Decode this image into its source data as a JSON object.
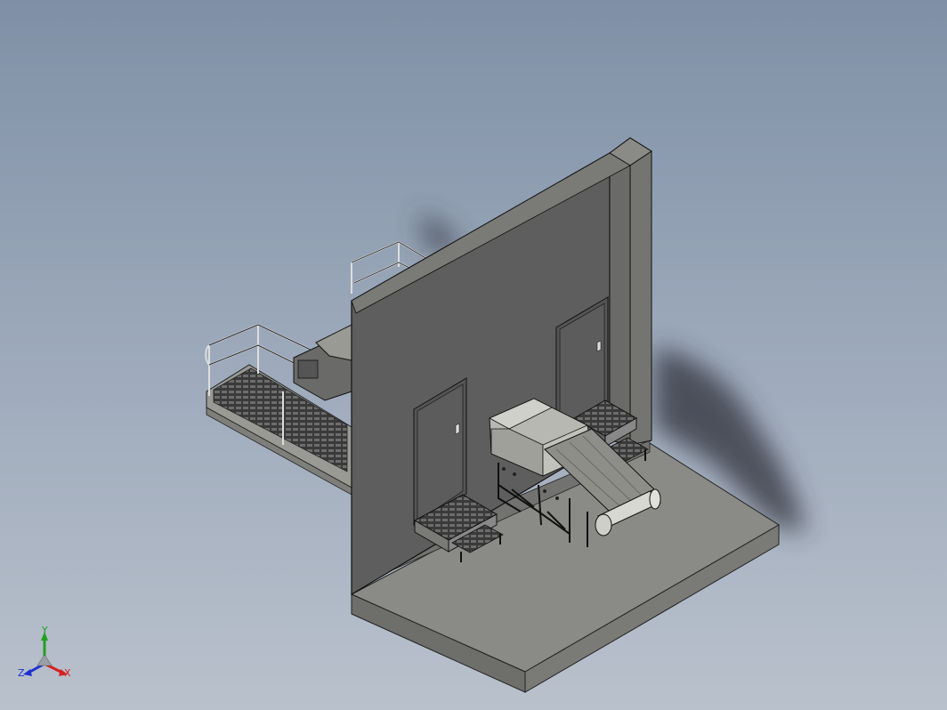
{
  "view": {
    "triad": {
      "x_label": "X",
      "y_label": "Y",
      "z_label": "Z"
    },
    "colors": {
      "background_top": "#7f90a6",
      "background_bottom": "#b9c1cc",
      "wall": "#5e5e5e",
      "floor_top": "#8a8a86",
      "floor_side": "#6e6e6a",
      "shadow": "#2e333b",
      "x_axis": "#d42020",
      "y_axis": "#20a020",
      "z_axis": "#2030d0"
    }
  }
}
